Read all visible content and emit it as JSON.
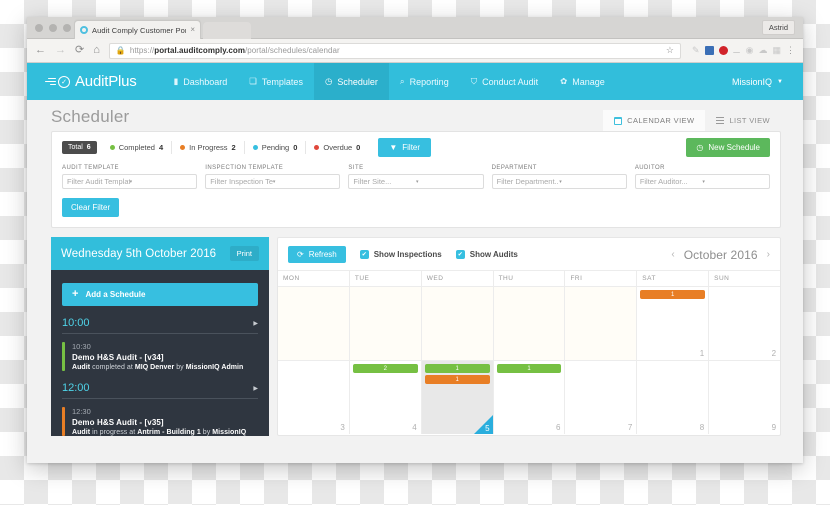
{
  "browser": {
    "tab_title": "Audit Comply Customer Portal",
    "tab_close": "×",
    "user_chip": "Astrid",
    "back_icon": "←",
    "forward_icon": "→",
    "reload_icon": "⟳",
    "home_icon": "⌂",
    "lock_icon": "🔒",
    "url_prefix": "https://",
    "url_domain": "portal.auditcomply.com",
    "url_path": "/portal/schedules/calendar",
    "star_icon": "☆",
    "menu_icon": "⋮"
  },
  "navbar": {
    "brand": "AuditPlus",
    "items": [
      {
        "label": "Dashboard",
        "icon": "▮",
        "active": false
      },
      {
        "label": "Templates",
        "icon": "❏",
        "active": false
      },
      {
        "label": "Scheduler",
        "icon": "◷",
        "active": true
      },
      {
        "label": "Reporting",
        "icon": "⌕",
        "active": false
      },
      {
        "label": "Conduct Audit",
        "icon": "⛉",
        "active": false
      },
      {
        "label": "Manage",
        "icon": "✿",
        "active": false
      }
    ],
    "account": "MissionIQ",
    "account_caret": "▼"
  },
  "page": {
    "title": "Scheduler",
    "views": [
      {
        "label": "CALENDAR VIEW",
        "active": true
      },
      {
        "label": "LIST VIEW",
        "active": false
      }
    ]
  },
  "filters": {
    "total_label": "Total",
    "total_count": "6",
    "status_badges": [
      {
        "label": "Completed",
        "count": "4",
        "color": "#76c043"
      },
      {
        "label": "In Progress",
        "count": "2",
        "color": "#e87e25"
      },
      {
        "label": "Pending",
        "count": "0",
        "color": "#37bfe0"
      },
      {
        "label": "Overdue",
        "count": "0",
        "color": "#e0483c"
      }
    ],
    "filter_button": "Filter",
    "filter_icon": "▼",
    "new_schedule_button": "New Schedule",
    "new_schedule_icon": "◷",
    "fields": [
      {
        "label": "AUDIT TEMPLATE",
        "placeholder": "Filter Audit Template..."
      },
      {
        "label": "INSPECTION TEMPLATE",
        "placeholder": "Filter Inspection Template..."
      },
      {
        "label": "SITE",
        "placeholder": "Filter Site..."
      },
      {
        "label": "DEPARTMENT",
        "placeholder": "Filter Department..."
      },
      {
        "label": "AUDITOR",
        "placeholder": "Filter Auditor..."
      }
    ],
    "clear_button": "Clear Filter",
    "arrow": "▾"
  },
  "sidebar": {
    "date": "Wednesday 5th October 2016",
    "print_button": "Print",
    "add_button": "Add a Schedule",
    "add_icon": "+",
    "slot_arrow": "▶",
    "slots": [
      {
        "time": "10:00",
        "events": [
          {
            "time": "10:30",
            "title": "Demo H&S Audit - [v34]",
            "status": "Audit",
            "detail": " completed at ",
            "location": "MIQ Denver",
            "by": " by ",
            "person": "MissionIQ Admin",
            "color": "#76c043"
          }
        ]
      },
      {
        "time": "12:00",
        "events": [
          {
            "time": "12:30",
            "title": "Demo H&S Audit - [v35]",
            "status": "Audit",
            "detail": " in progress at ",
            "location": "Antrim - Building 1",
            "by": " by ",
            "person": "MissionIQ",
            "color": "#e87e25"
          }
        ]
      }
    ]
  },
  "calendar": {
    "refresh_button": "Refresh",
    "refresh_icon": "⟳",
    "checkboxes": [
      {
        "label": "Show Inspections",
        "checked": true
      },
      {
        "label": "Show Audits",
        "checked": true
      }
    ],
    "check_glyph": "✔",
    "prev_icon": "‹",
    "next_icon": "›",
    "month_label": "October 2016",
    "day_headers": [
      "MON",
      "TUE",
      "WED",
      "THU",
      "FRI",
      "SAT",
      "SUN"
    ],
    "weeks": [
      {
        "days": [
          {
            "num": "",
            "other": true,
            "today": false,
            "events": []
          },
          {
            "num": "",
            "other": true,
            "today": false,
            "events": []
          },
          {
            "num": "",
            "other": true,
            "today": false,
            "events": []
          },
          {
            "num": "",
            "other": true,
            "today": false,
            "events": []
          },
          {
            "num": "",
            "other": true,
            "today": false,
            "events": []
          },
          {
            "num": "1",
            "other": false,
            "today": false,
            "events": [
              {
                "count": "1",
                "color": "orange"
              }
            ]
          },
          {
            "num": "2",
            "other": false,
            "today": false,
            "events": []
          }
        ]
      },
      {
        "days": [
          {
            "num": "3",
            "other": false,
            "today": false,
            "events": []
          },
          {
            "num": "4",
            "other": false,
            "today": false,
            "events": [
              {
                "count": "2",
                "color": "green"
              }
            ]
          },
          {
            "num": "5",
            "other": false,
            "today": true,
            "events": [
              {
                "count": "1",
                "color": "green"
              },
              {
                "count": "1",
                "color": "orange"
              }
            ]
          },
          {
            "num": "6",
            "other": false,
            "today": false,
            "events": [
              {
                "count": "1",
                "color": "green"
              }
            ]
          },
          {
            "num": "7",
            "other": false,
            "today": false,
            "events": []
          },
          {
            "num": "8",
            "other": false,
            "today": false,
            "events": []
          },
          {
            "num": "9",
            "other": false,
            "today": false,
            "events": []
          }
        ]
      }
    ]
  }
}
